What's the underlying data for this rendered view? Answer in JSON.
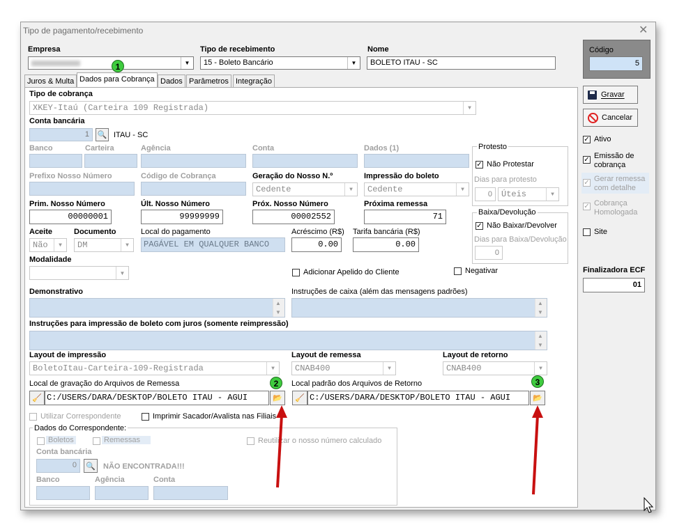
{
  "window": {
    "title": "Tipo de pagamento/recebimento"
  },
  "header": {
    "empresa_label": "Empresa",
    "tipo_recebimento_label": "Tipo de recebimento",
    "tipo_recebimento_value": "15 - Boleto Bancário",
    "nome_label": "Nome",
    "nome_value": "BOLETO ITAU - SC",
    "codigo_label": "Código",
    "codigo_value": "5"
  },
  "tabs": [
    "Juros & Multa",
    "Dados para Cobrança",
    "Dados",
    "Parâmetros",
    "Integração"
  ],
  "form": {
    "tipo_cobranca_label": "Tipo de cobrança",
    "tipo_cobranca_value": "XKEY-Itaú (Carteira 109 Registrada)",
    "conta_bancaria_label": "Conta bancária",
    "conta_bancaria_value": "1",
    "conta_bancaria_desc": "ITAU - SC",
    "banco_label": "Banco",
    "carteira_label": "Carteira",
    "agencia_label": "Agência",
    "conta_label": "Conta",
    "dados1_label": "Dados (1)",
    "prefixo_label": "Prefixo Nosso Número",
    "codigo_cobranca_label": "Código de Cobrança",
    "geracao_label": "Geração do Nosso N.º",
    "geracao_value": "Cedente",
    "impressao_label": "Impressão do boleto",
    "impressao_value": "Cedente",
    "prim_label": "Prim. Nosso Número",
    "prim_value": "00000001",
    "ult_label": "Últ. Nosso Número",
    "ult_value": "99999999",
    "prox_label": "Próx. Nosso Número",
    "prox_value": "00002552",
    "proxima_remessa_label": "Próxima remessa",
    "proxima_remessa_value": "71",
    "aceite_label": "Aceite",
    "aceite_value": "Não",
    "documento_label": "Documento",
    "documento_value": "DM",
    "local_pagamento_label": "Local do pagamento",
    "local_pagamento_value": "PAGÁVEL EM QUALQUER BANCO",
    "acrescimo_label": "Acréscimo (R$)",
    "acrescimo_value": "0.00",
    "tarifa_label": "Tarifa bancária (R$)",
    "tarifa_value": "0.00",
    "modalidade_label": "Modalidade",
    "adicionar_apelido_label": "Adicionar Apelido do Cliente",
    "negativar_label": "Negativar",
    "demonstrativo_label": "Demonstrativo",
    "instrucoes_caixa_label": "Instruções de caixa (além das mensagens padrões)",
    "instrucoes_juros_label": "Instruções para impressão de boleto com juros (somente reimpressão)",
    "layout_impressao_label": "Layout de impressão",
    "layout_impressao_value": "BoletoItau-Carteira-109-Registrada",
    "layout_remessa_label": "Layout de remessa",
    "layout_remessa_value": "CNAB400",
    "layout_retorno_label": "Layout de retorno",
    "layout_retorno_value": "CNAB400",
    "local_remessa_label": "Local de gravação do Arquivos de Remessa",
    "local_remessa_value": "C:/USERS/DARA/DESKTOP/BOLETO ITAU - AGUI",
    "local_retorno_label": "Local padrão dos Arquivos de Retorno",
    "local_retorno_value": "C:/USERS/DARA/DESKTOP/BOLETO ITAU - AGUI",
    "utilizar_correspondente_label": "Utilizar Correspondente",
    "imprimir_sacador_label": "Imprimir Sacador/Avalista nas Filiais"
  },
  "protesto": {
    "group_label": "Protesto",
    "nao_protestar_label": "Não Protestar",
    "dias_label": "Dias para protesto",
    "dias_value": "0",
    "tipo_dias_value": "Úteis"
  },
  "baixa": {
    "group_label": "Baixa/Devolução",
    "nao_baixar_label": "Não Baixar/Devolver",
    "dias_label": "Dias para Baixa/Devolução",
    "dias_value": "0"
  },
  "correspondente": {
    "group_label": "Dados do Correspondente:",
    "boletos_label": "Boletos",
    "remessas_label": "Remessas",
    "reutilizar_label": "Reutilizar o nosso número calculado",
    "conta_label": "Conta bancária",
    "conta_value": "0",
    "nao_encontrada": "NÃO ENCONTRADA!!!",
    "banco_label": "Banco",
    "agencia_label": "Agência",
    "conta2_label": "Conta"
  },
  "sidebar": {
    "gravar_label": "Gravar",
    "cancelar_label": "Cancelar",
    "ativo_label": "Ativo",
    "emissao_label": "Emissão de cobrança",
    "gerar_remessa_label": "Gerar remessa com detalhe",
    "cobranca_homologada_label": "Cobrança Homologada",
    "site_label": "Site",
    "finalizadora_label": "Finalizadora ECF",
    "finalizadora_value": "01"
  },
  "annotations": [
    "1",
    "2",
    "3"
  ],
  "colors": {
    "field_disabled": "#cfdff0",
    "annotation_green": "#3fcc3f",
    "arrow_red": "#d01010"
  }
}
